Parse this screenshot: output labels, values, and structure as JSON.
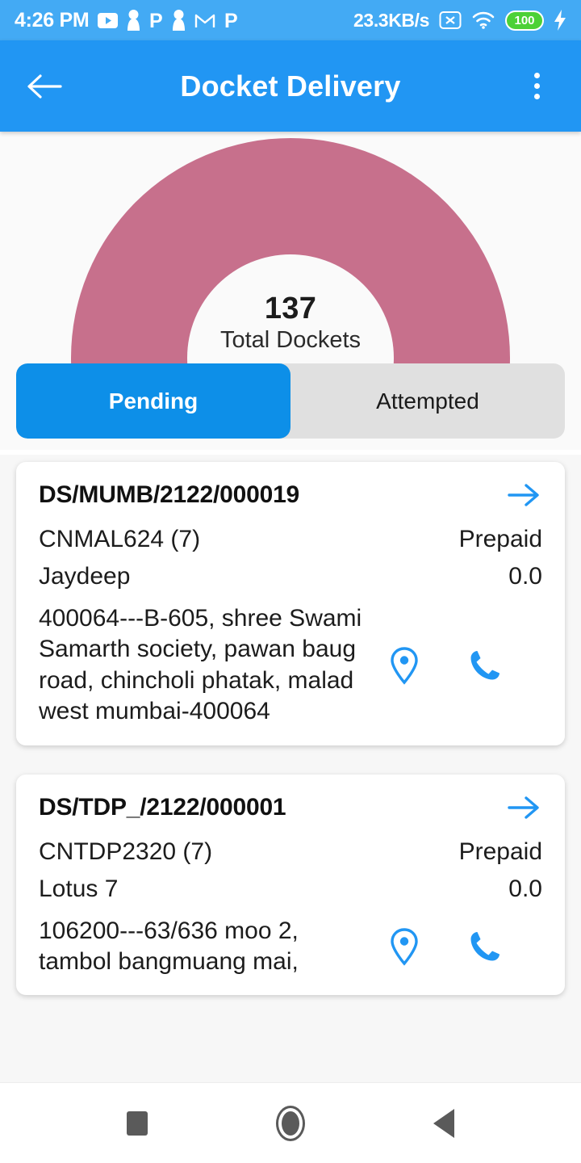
{
  "status_bar": {
    "time": "4:26 PM",
    "network_speed": "23.3KB/s",
    "battery_level": "100",
    "notification_icons": [
      "youtube-icon",
      "person-icon",
      "p-app-icon",
      "person-icon",
      "gmail-icon",
      "p-app-icon"
    ],
    "system_icons": [
      "no-sim-icon",
      "wifi-icon",
      "battery-icon",
      "charging-bolt-icon"
    ],
    "bg_color": "#43aaf4"
  },
  "app_bar": {
    "title": "Docket Delivery",
    "back_icon": "back-arrow-icon",
    "menu_icon": "overflow-menu-icon",
    "bg_color": "#2196f3"
  },
  "chart_data": {
    "type": "pie",
    "title": "Total Dockets",
    "center_value": "137",
    "center_caption": "Total Dockets",
    "categories": [
      "Total Dockets"
    ],
    "values": [
      137
    ],
    "colors": [
      "#c7708c"
    ],
    "legend_position": "none",
    "grid": false
  },
  "tabs": {
    "items": [
      {
        "label": "Pending",
        "active": true
      },
      {
        "label": "Attempted",
        "active": false
      }
    ],
    "active_color": "#0d8fe8",
    "track_color": "#e0e0e0"
  },
  "dockets": [
    {
      "docket_no": "DS/MUMB/2122/000019",
      "consignment": "CNMAL624 (7)",
      "payment_mode": "Prepaid",
      "customer": "Jaydeep",
      "amount": "0.0",
      "address": "400064---B-605, shree Swami Samarth society, pawan baug road, chincholi phatak, malad west mumbai-400064"
    },
    {
      "docket_no": "DS/TDP_/2122/000001",
      "consignment": "CNTDP2320 (7)",
      "payment_mode": "Prepaid",
      "customer": "Lotus 7",
      "amount": "0.0",
      "address": "106200---63/636 moo 2, tambol bangmuang mai,"
    }
  ],
  "card_icons": {
    "open_icon": "arrow-right-icon",
    "map_icon": "location-pin-icon",
    "call_icon": "phone-icon",
    "accent_color": "#2196f3"
  },
  "nav_bar": {
    "recents_icon": "recents-square-icon",
    "home_icon": "home-circle-icon",
    "back_icon": "back-triangle-icon"
  }
}
